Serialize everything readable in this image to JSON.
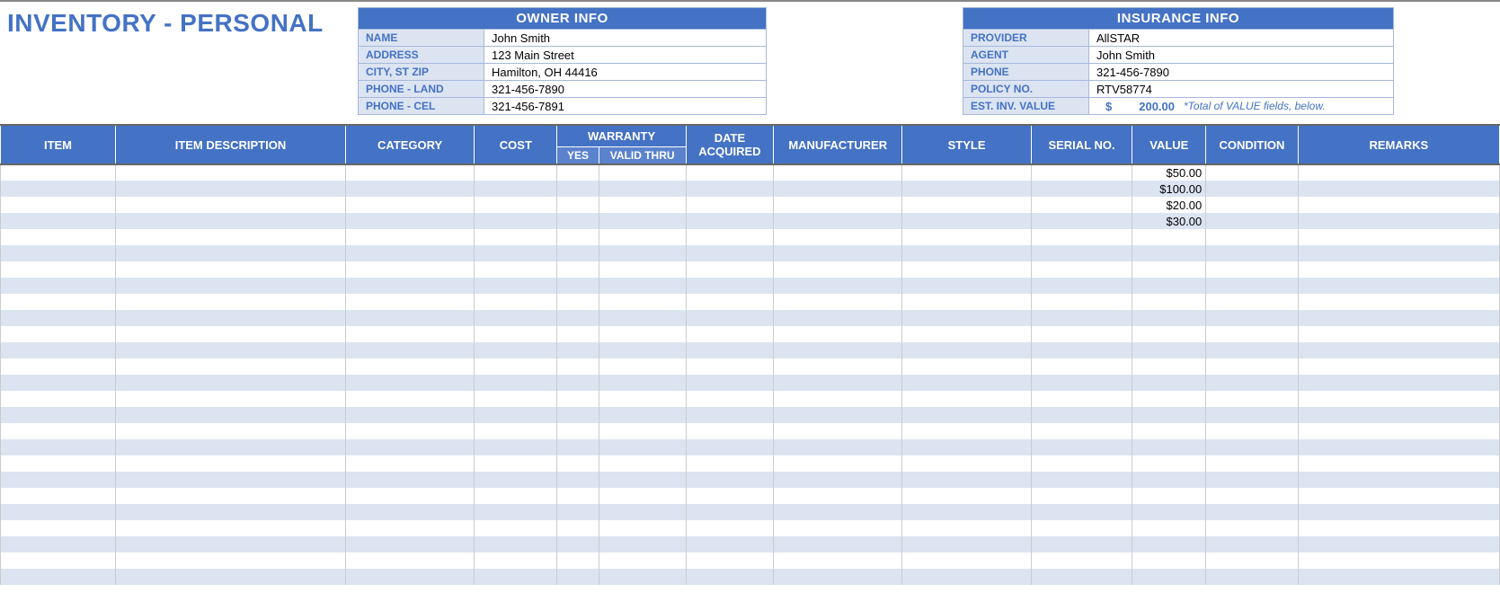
{
  "title": "INVENTORY - PERSONAL",
  "owner": {
    "header": "OWNER INFO",
    "rows": [
      {
        "label": "NAME",
        "value": "John Smith"
      },
      {
        "label": "ADDRESS",
        "value": "123 Main Street"
      },
      {
        "label": "CITY, ST  ZIP",
        "value": "Hamilton, OH  44416"
      },
      {
        "label": "PHONE - LAND",
        "value": "321-456-7890"
      },
      {
        "label": "PHONE - CEL",
        "value": "321-456-7891"
      }
    ]
  },
  "insurance": {
    "header": "INSURANCE INFO",
    "rows": [
      {
        "label": "PROVIDER",
        "value": "AllSTAR"
      },
      {
        "label": "AGENT",
        "value": "John Smith"
      },
      {
        "label": "PHONE",
        "value": "321-456-7890"
      },
      {
        "label": "POLICY NO.",
        "value": "RTV58774"
      }
    ],
    "est_label": "EST. INV. VALUE",
    "est_currency": "$",
    "est_value": "200.00",
    "est_note": "*Total of VALUE fields, below."
  },
  "columns": {
    "item": "ITEM",
    "desc": "ITEM DESCRIPTION",
    "cat": "CATEGORY",
    "cost": "COST",
    "warranty": "WARRANTY",
    "wyes": "YES",
    "wthru": "VALID THRU",
    "date": "DATE ACQUIRED",
    "mfr": "MANUFACTURER",
    "style": "STYLE",
    "serial": "SERIAL NO.",
    "value": "VALUE",
    "cond": "CONDITION",
    "remarks": "REMARKS"
  },
  "rows": [
    {
      "value": "$50.00"
    },
    {
      "value": "$100.00"
    },
    {
      "value": "$20.00"
    },
    {
      "value": "$30.00"
    },
    {},
    {},
    {},
    {},
    {},
    {},
    {},
    {},
    {},
    {},
    {},
    {},
    {},
    {},
    {},
    {},
    {},
    {},
    {},
    {},
    {},
    {}
  ]
}
